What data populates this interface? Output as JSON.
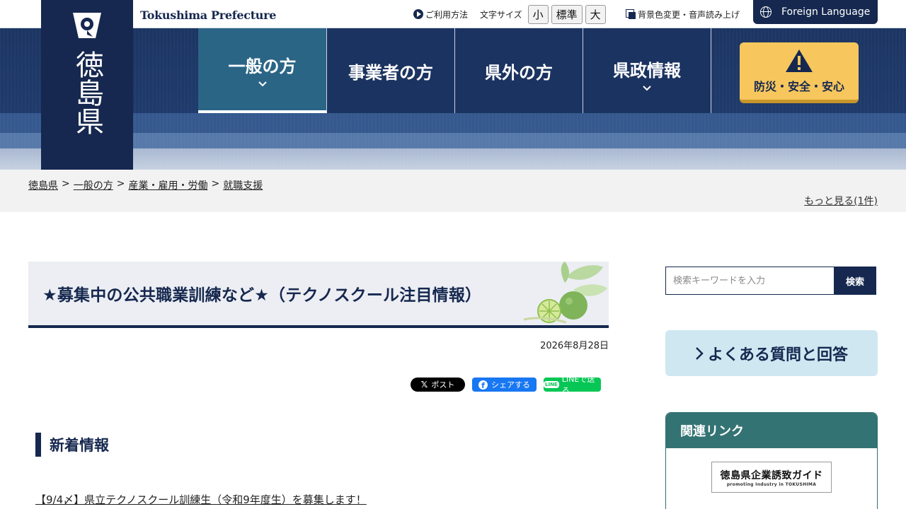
{
  "header": {
    "brand_en": "Tokushima Prefecture",
    "logo_kanji": "徳島県",
    "guide_link": "ご利用方法",
    "font_size_label": "文字サイズ",
    "font_sizes": [
      "小",
      "標準",
      "大"
    ],
    "bg_change": "背景色変更・音声読み上げ",
    "foreign_language": "Foreign Language",
    "nav": [
      {
        "label": "一般の方",
        "has_menu": true,
        "active": true
      },
      {
        "label": "事業者の方",
        "has_menu": false
      },
      {
        "label": "県外の方",
        "has_menu": false
      },
      {
        "label": "県政情報",
        "has_menu": true
      }
    ],
    "disaster_label": "防災・安全・安心"
  },
  "breadcrumb": {
    "items": [
      "徳島県",
      "一般の方",
      "産業・雇用・労働",
      "就職支援"
    ],
    "separator": ">",
    "more": "もっと見る(1件)"
  },
  "main": {
    "title": "★募集中の公共職業訓練など★（テクノスクール注目情報）",
    "date": "2026年8月28日",
    "sns": {
      "x": "ポスト",
      "facebook": "シェアする",
      "line": "LINEで送る"
    },
    "section_heading": "新着情報",
    "news_items": [
      "【9/4〆】県立テクノスクール訓練生（令和9年度生）を募集します！"
    ]
  },
  "sidebar": {
    "search_placeholder": "検索キーワードを入力",
    "search_button": "検索",
    "faq": "よくある質問と回答",
    "related_heading": "関連リンク",
    "banner_title": "徳島県企業誘致ガイド",
    "banner_sub": "promoting Industry in TOKUSHIMA"
  },
  "colors": {
    "navy": "#16284f",
    "nav_active": "#2b6586",
    "disaster": "#f7c75d",
    "faq_bg": "#cfe7f1",
    "related_head": "#347373"
  }
}
